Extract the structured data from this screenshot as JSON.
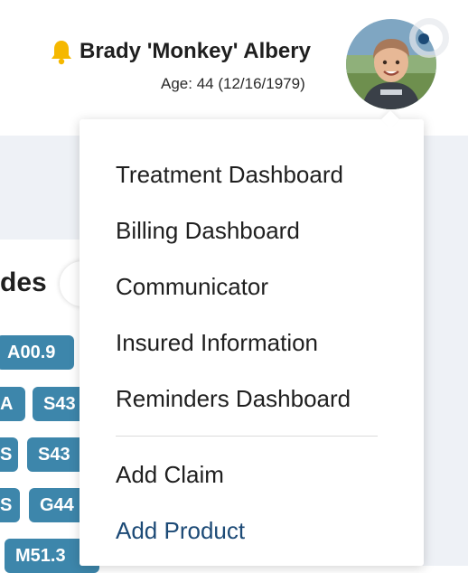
{
  "patient": {
    "name": "Brady 'Monkey' Albery",
    "age": "Age: 44 (12/16/1979)"
  },
  "colors": {
    "accent": "#3d86ab",
    "link": "#1c4a76",
    "bell": "#f5b800"
  },
  "background_card": {
    "title_fragment": "des",
    "chips": [
      "A00.9",
      "A",
      "S43",
      "S",
      "S43",
      "S",
      "G44",
      "M51.3"
    ]
  },
  "menu": {
    "items": [
      "Treatment Dashboard",
      "Billing Dashboard",
      "Communicator",
      "Insured Information",
      "Reminders Dashboard",
      "Add Claim",
      "Add Product"
    ]
  }
}
